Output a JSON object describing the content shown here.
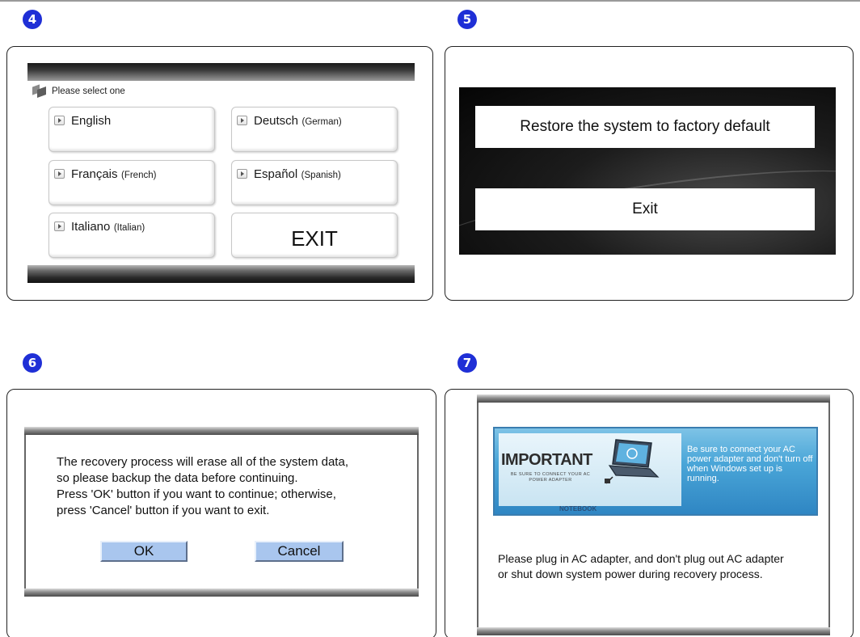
{
  "steps": {
    "s4": "4",
    "s5": "5",
    "s6": "6",
    "s7": "7"
  },
  "language_screen": {
    "header": "Please select one",
    "options": [
      {
        "name": "English",
        "sub": ""
      },
      {
        "name": "Deutsch",
        "sub": "(German)"
      },
      {
        "name": "Français",
        "sub": "(French)"
      },
      {
        "name": "Español",
        "sub": "(Spanish)"
      },
      {
        "name": "Italiano",
        "sub": "(Italian)"
      }
    ],
    "exit_label": "EXIT"
  },
  "restore_screen": {
    "restore_label": "Restore the system to factory default",
    "exit_label": "Exit"
  },
  "warning_dialog": {
    "lines": [
      "The recovery process will erase all of the system data,",
      "so please backup the data before continuing.",
      "Press 'OK' button if you want to continue; otherwise,",
      "press 'Cancel' button if you want to exit."
    ],
    "ok_label": "OK",
    "cancel_label": "Cancel"
  },
  "ac_dialog": {
    "banner_title": "IMPORTANT",
    "banner_small": "BE SURE TO CONNECT YOUR AC POWER ADAPTER",
    "banner_text": "Be sure to connect your AC power adapter and don't turn off when Windows set up is running.",
    "banner_footer": "NOTEBOOK",
    "lines": [
      "Please plug in AC adapter, and don't plug out AC adapter",
      "or shut down system power during recovery process."
    ]
  },
  "colors": {
    "step_badge": "#1f2fd6",
    "button_blue": "#a9c6ee",
    "banner_blue": "#4aa6d8"
  }
}
